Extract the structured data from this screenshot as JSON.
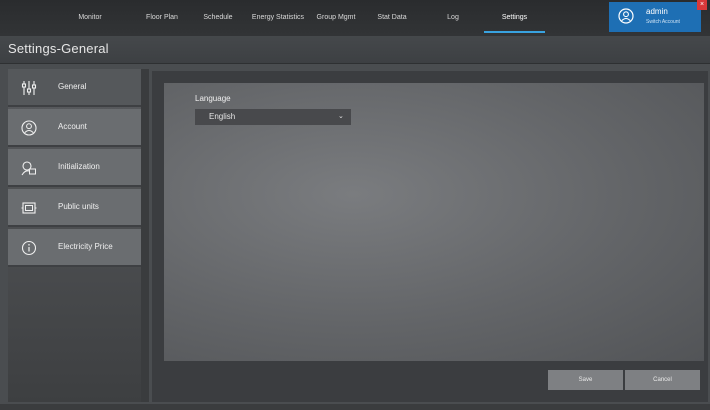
{
  "nav": {
    "items": [
      {
        "label": "Monitor"
      },
      {
        "label": "Floor Plan"
      },
      {
        "label": "Schedule"
      },
      {
        "label": "Energy Statistics"
      },
      {
        "label": "Group Mgmt"
      },
      {
        "label": "Stat Data"
      },
      {
        "label": "Log"
      },
      {
        "label": "Settings",
        "active": true
      }
    ],
    "accent_color": "#39a3e0"
  },
  "user": {
    "name": "admin",
    "switch_label": "Switch Account",
    "box_color": "#1e6fb4"
  },
  "page": {
    "title": "Settings-General"
  },
  "sidebar": {
    "items": [
      {
        "label": "General",
        "icon": "sliders-icon",
        "active": true
      },
      {
        "label": "Account",
        "icon": "user-circle-icon"
      },
      {
        "label": "Initialization",
        "icon": "user-monitor-icon"
      },
      {
        "label": "Public units",
        "icon": "unit-box-icon"
      },
      {
        "label": "Electricity Price",
        "icon": "info-circle-icon"
      }
    ]
  },
  "general": {
    "language_label": "Language",
    "language_value": "English"
  },
  "actions": {
    "save_label": "Save",
    "cancel_label": "Cancel"
  }
}
